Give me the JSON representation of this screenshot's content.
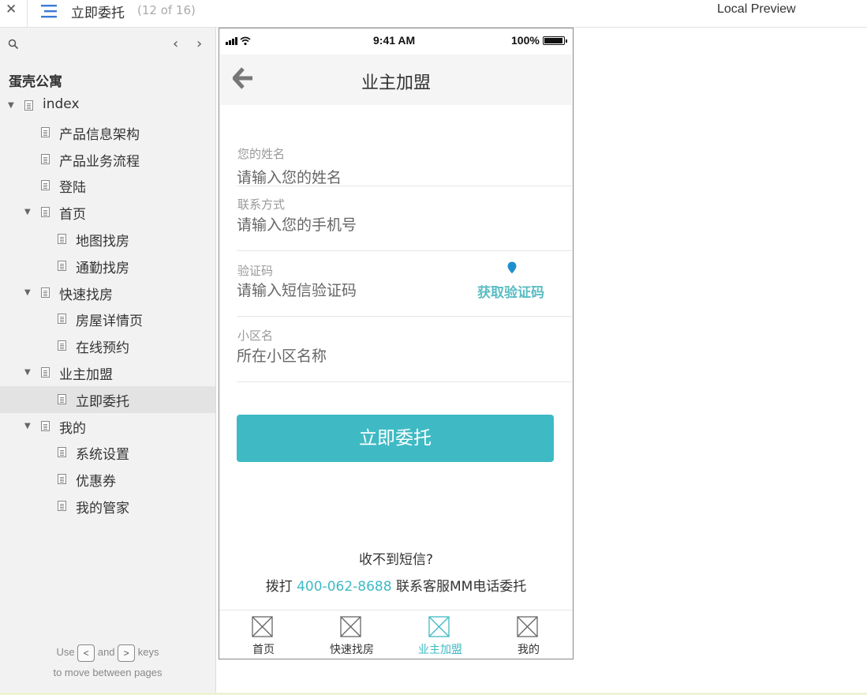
{
  "topbar": {
    "close_glyph": "✕",
    "page_title": "立即委托",
    "page_count": "(12 of 16)",
    "preview_label": "Local Preview"
  },
  "sidebar": {
    "project_name": "蛋壳公寓",
    "prev_glyph": "‹",
    "next_glyph": "›",
    "tree": [
      {
        "label": "index",
        "level": 0,
        "expanded": true
      },
      {
        "label": "产品信息架构",
        "level": 1
      },
      {
        "label": "产品业务流程",
        "level": 1
      },
      {
        "label": "登陆",
        "level": 1
      },
      {
        "label": "首页",
        "level": 1,
        "expanded": true
      },
      {
        "label": "地图找房",
        "level": 2
      },
      {
        "label": "通勤找房",
        "level": 2
      },
      {
        "label": "快速找房",
        "level": 1,
        "expanded": true
      },
      {
        "label": "房屋详情页",
        "level": 2
      },
      {
        "label": "在线预约",
        "level": 2
      },
      {
        "label": "业主加盟",
        "level": 1,
        "expanded": true
      },
      {
        "label": "立即委托",
        "level": 2,
        "selected": true
      },
      {
        "label": "我的",
        "level": 1,
        "expanded": true
      },
      {
        "label": "系统设置",
        "level": 2
      },
      {
        "label": "优惠券",
        "level": 2
      },
      {
        "label": "我的管家",
        "level": 2
      }
    ],
    "hint": {
      "use": "Use",
      "key_prev": "<",
      "and": "and",
      "key_next": ">",
      "keys": "keys",
      "line2": "to move between pages"
    }
  },
  "phone": {
    "status": {
      "time": "9:41 AM",
      "battery": "100%"
    },
    "nav_title": "业主加盟",
    "fields": [
      {
        "label": "您的姓名",
        "placeholder": "请输入您的姓名"
      },
      {
        "label": "联系方式",
        "placeholder": "请输入您的手机号"
      },
      {
        "label": "验证码",
        "placeholder": "请输入短信验证码"
      },
      {
        "label": "小区名",
        "placeholder": "所在小区名称"
      }
    ],
    "verify_button": "获取验证码",
    "submit_button": "立即委托",
    "no_sms": "收不到短信?",
    "call": {
      "prefix": "拨打",
      "number": "400-062-8688",
      "suffix": "联系客服MM电话委托"
    },
    "tabs": [
      {
        "label": "首页",
        "active": false
      },
      {
        "label": "快速找房",
        "active": false
      },
      {
        "label": "业主加盟",
        "active": true
      },
      {
        "label": "我的",
        "active": false
      }
    ],
    "accent_color": "#3fbac4"
  }
}
